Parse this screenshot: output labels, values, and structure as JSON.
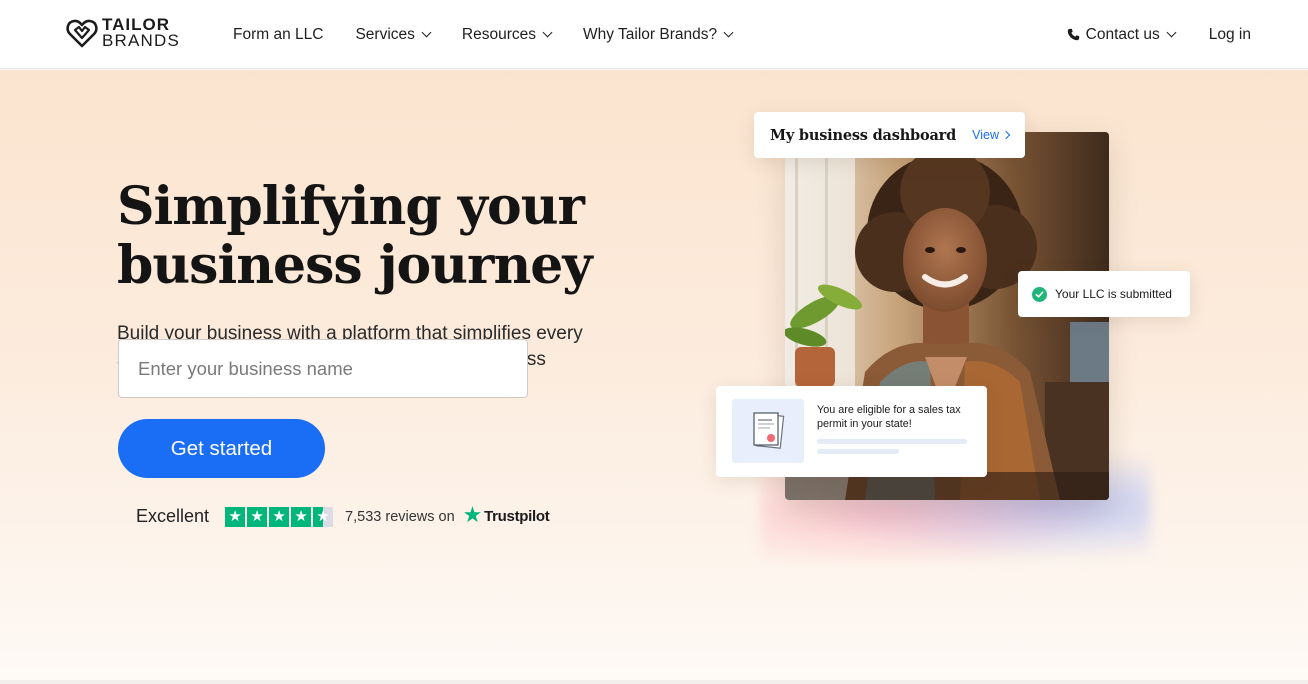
{
  "brand": {
    "line1": "TAILOR",
    "line2": "BRANDS"
  },
  "nav": {
    "links": [
      {
        "label": "Form an LLC",
        "dropdown": false
      },
      {
        "label": "Services",
        "dropdown": true
      },
      {
        "label": "Resources",
        "dropdown": true
      },
      {
        "label": "Why Tailor Brands?",
        "dropdown": true
      }
    ],
    "contact_label": "Contact us",
    "login_label": "Log in"
  },
  "hero": {
    "headline_line1": "Simplifying your",
    "headline_line2": "business journey",
    "subhead": "Build your business with a platform that simplifies every step of starting, managing, and growing a business",
    "input_placeholder": "Enter your business name",
    "cta_label": "Get started"
  },
  "rating": {
    "word": "Excellent",
    "stars": 4.5,
    "count_text": "7,533 reviews on",
    "platform": "Trustpilot"
  },
  "illustration": {
    "dashboard_title": "My business dashboard",
    "dashboard_link": "View",
    "llc_status": "Your LLC is submitted",
    "tax_notice": "You are eligible for a sales tax permit in your state!"
  },
  "colors": {
    "accent": "#1a6df5",
    "trustpilot": "#00b67a",
    "success": "#1fb57a",
    "hero_bg_top": "#fbe4cf"
  }
}
